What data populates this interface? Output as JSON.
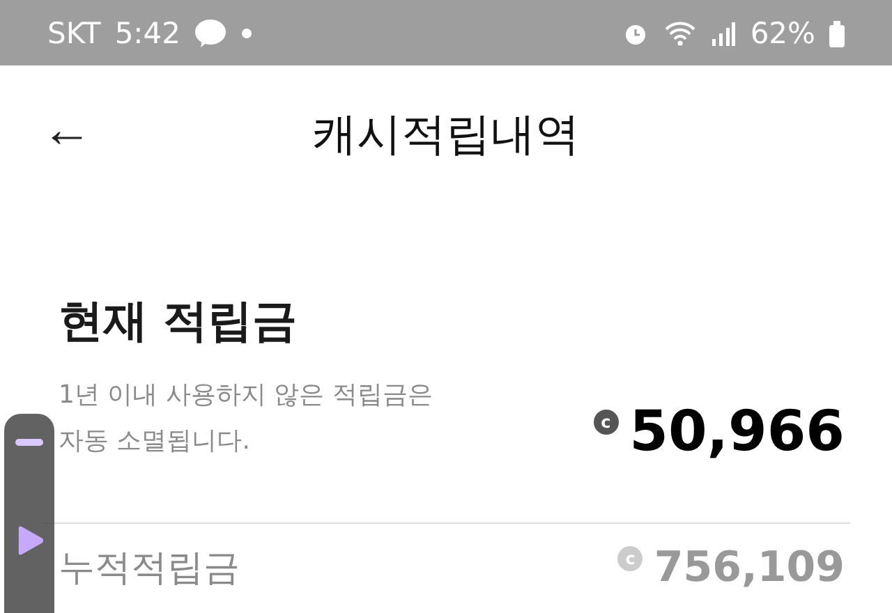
{
  "status_bar": {
    "carrier": "SKT",
    "time": "5:42",
    "battery": "62%"
  },
  "header": {
    "back": "←",
    "title": "캐시적립내역"
  },
  "current": {
    "title": "현재 적립금",
    "note": "1년 이내 사용하지 않은 적립금은\n자동 소멸됩니다.",
    "coin": "c",
    "amount": "50,966"
  },
  "total": {
    "label": "누적적립금",
    "coin": "c",
    "amount": "756,109"
  },
  "floating_widget": {
    "kind": "player"
  }
}
